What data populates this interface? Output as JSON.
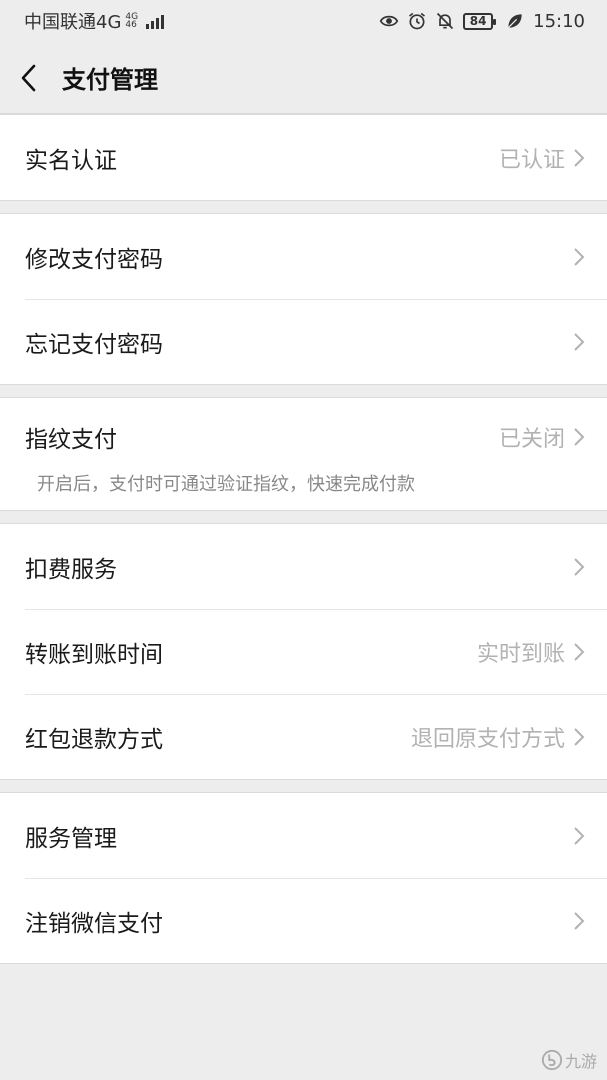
{
  "status_bar": {
    "carrier": "中国联通4G",
    "net_top": "4G",
    "net_bottom": "46",
    "battery": "84",
    "time": "15:10"
  },
  "nav": {
    "title": "支付管理",
    "back_icon": "chevron-left-icon"
  },
  "groups": [
    {
      "items": [
        {
          "label": "实名认证",
          "value": "已认证"
        }
      ]
    },
    {
      "items": [
        {
          "label": "修改支付密码",
          "value": ""
        },
        {
          "label": "忘记支付密码",
          "value": ""
        }
      ]
    },
    {
      "items": [
        {
          "label": "指纹支付",
          "value": "已关闭",
          "desc": "开启后，支付时可通过验证指纹，快速完成付款"
        }
      ]
    },
    {
      "items": [
        {
          "label": "扣费服务",
          "value": ""
        },
        {
          "label": "转账到账时间",
          "value": "实时到账"
        },
        {
          "label": "红包退款方式",
          "value": "退回原支付方式"
        }
      ]
    },
    {
      "items": [
        {
          "label": "服务管理",
          "value": ""
        },
        {
          "label": "注销微信支付",
          "value": ""
        }
      ]
    }
  ],
  "watermark": {
    "text": "九游"
  },
  "colors": {
    "background": "#ededed",
    "cell": "#ffffff",
    "secondary_text": "#b2b2b2"
  }
}
